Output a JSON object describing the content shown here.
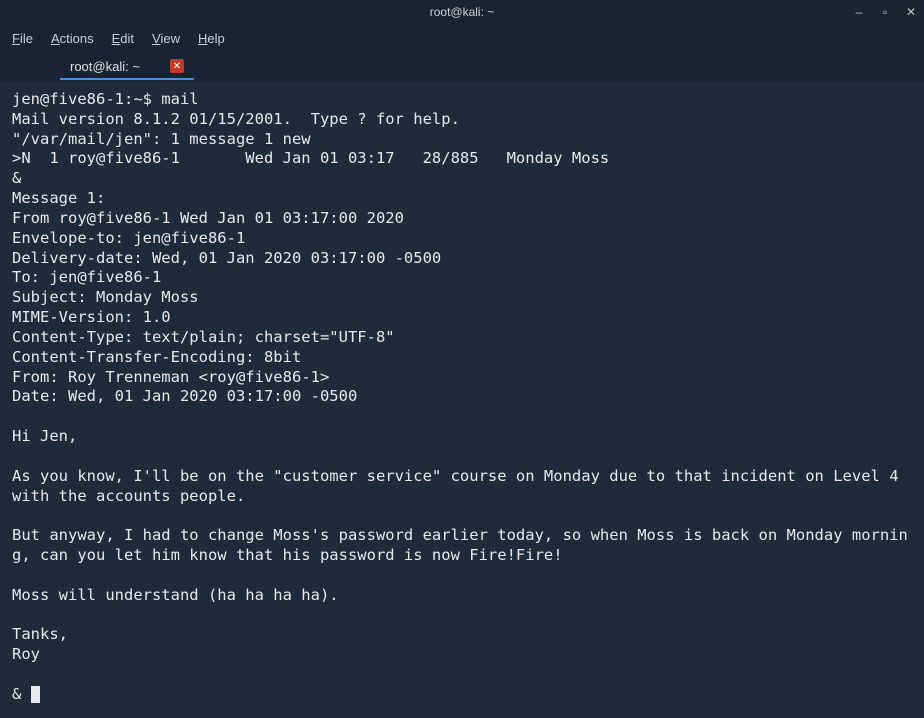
{
  "window": {
    "title": "root@kali: ~"
  },
  "menu": {
    "file": "File",
    "actions": "Actions",
    "edit": "Edit",
    "view": "View",
    "help": "Help"
  },
  "tab": {
    "label": "root@kali: ~"
  },
  "terminal": {
    "lines": [
      "jen@five86-1:~$ mail",
      "Mail version 8.1.2 01/15/2001.  Type ? for help.",
      "\"/var/mail/jen\": 1 message 1 new",
      ">N  1 roy@five86-1       Wed Jan 01 03:17   28/885   Monday Moss",
      "&",
      "Message 1:",
      "From roy@five86-1 Wed Jan 01 03:17:00 2020",
      "Envelope-to: jen@five86-1",
      "Delivery-date: Wed, 01 Jan 2020 03:17:00 -0500",
      "To: jen@five86-1",
      "Subject: Monday Moss",
      "MIME-Version: 1.0",
      "Content-Type: text/plain; charset=\"UTF-8\"",
      "Content-Transfer-Encoding: 8bit",
      "From: Roy Trenneman <roy@five86-1>",
      "Date: Wed, 01 Jan 2020 03:17:00 -0500",
      "",
      "Hi Jen,",
      "",
      "As you know, I'll be on the \"customer service\" course on Monday due to that incident on Level 4 with the accounts people.",
      "",
      "But anyway, I had to change Moss's password earlier today, so when Moss is back on Monday morning, can you let him know that his password is now Fire!Fire!",
      "",
      "Moss will understand (ha ha ha ha).",
      "",
      "Tanks,",
      "Roy",
      "",
      "& "
    ]
  }
}
